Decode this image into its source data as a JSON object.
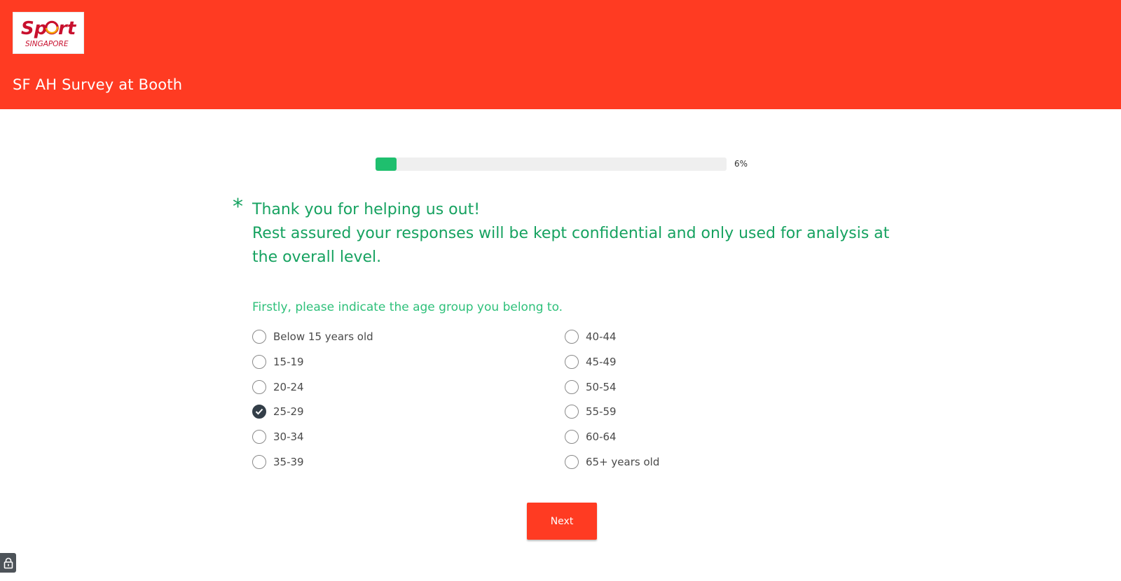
{
  "header": {
    "logo": {
      "brand": "Sport",
      "tagline": "SINGAPORE"
    },
    "survey_title": "SF AH Survey at Booth",
    "colors": {
      "background": "#ff3b22",
      "logo_text": "#c8102e",
      "logo_accent": "#f7a600"
    }
  },
  "progress": {
    "percent": 6,
    "label": "6%",
    "fill_color": "#1fbf6e"
  },
  "question": {
    "required_marker": "*",
    "lines": [
      "Thank you for helping us out!",
      "Rest assured your responses will be kept confidential and only used for analysis at",
      "the overall level."
    ],
    "sub_question": "Firstly, please indicate the age group you belong to.",
    "color": "#16a260"
  },
  "options": {
    "left_column": [
      {
        "label": "Below 15 years old",
        "checked": false
      },
      {
        "label": "15-19",
        "checked": false
      },
      {
        "label": "20-24",
        "checked": false
      },
      {
        "label": "25-29",
        "checked": true
      },
      {
        "label": "30-34",
        "checked": false
      },
      {
        "label": "35-39",
        "checked": false
      }
    ],
    "right_column": [
      {
        "label": "40-44",
        "checked": false
      },
      {
        "label": "45-49",
        "checked": false
      },
      {
        "label": "50-54",
        "checked": false
      },
      {
        "label": "55-59",
        "checked": false
      },
      {
        "label": "60-64",
        "checked": false
      },
      {
        "label": "65+ years old",
        "checked": false
      }
    ]
  },
  "actions": {
    "next_label": "Next"
  },
  "footer": {
    "lock_icon": "lock-icon"
  }
}
